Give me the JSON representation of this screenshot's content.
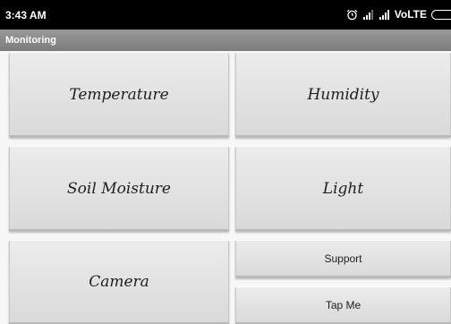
{
  "status_bar": {
    "time": "3:43 AM",
    "network_label": "VoLTE",
    "icons": [
      "alarm-icon",
      "signal-icon",
      "signal-icon",
      "battery-icon"
    ]
  },
  "action_bar": {
    "title": "Monitoring"
  },
  "tiles": {
    "temperature": "Temperature",
    "humidity": "Humidity",
    "soil_moisture": "Soil Moisture",
    "light": "Light",
    "camera": "Camera",
    "support": "Support",
    "tap_me": "Tap Me"
  },
  "colors": {
    "status_bar": "#000000",
    "action_bar": "#8a8a8a",
    "tile": "#e2e2e2",
    "tile_text": "#1e1e1e"
  }
}
